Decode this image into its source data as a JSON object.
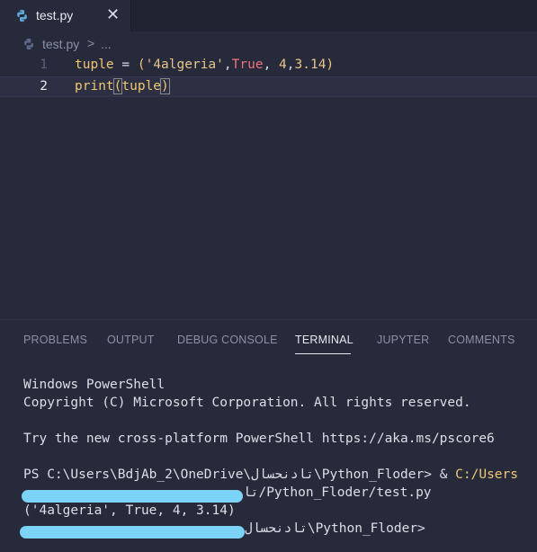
{
  "tab": {
    "filename": "test.py",
    "close_glyph": "✕",
    "icon": "python-icon"
  },
  "breadcrumb": {
    "file": "test.py",
    "separator": ">",
    "ellipsis": "..."
  },
  "editor": {
    "lines": [
      {
        "number": "1"
      },
      {
        "number": "2"
      }
    ],
    "line1": {
      "var": "tuple",
      "eq": " = ",
      "open": "(",
      "str": "'4algeria'",
      "comma1": ",",
      "kw": "True",
      "comma2": ", ",
      "n1": "4",
      "comma3": ",",
      "n2": "3.14",
      "close": ")"
    },
    "line2": {
      "fn": "print",
      "open": "(",
      "arg": "tuple",
      "close": ")"
    }
  },
  "panel": {
    "tabs": [
      "PROBLEMS",
      "OUTPUT",
      "DEBUG CONSOLE",
      "TERMINAL",
      "JUPYTER",
      "COMMENTS"
    ],
    "active_tab": "TERMINAL"
  },
  "terminal": {
    "line1": "Windows PowerShell",
    "line2": "Copyright (C) Microsoft Corporation. All rights reserved.",
    "line3": "Try the new cross-platform PowerShell https://aka.ms/pscore6",
    "line4_prefix": "PS C:\\Users\\BdjAb_2\\OneDrive\\تادنحسال\\Python_Floder> & ",
    "line4_cmd": "C:/Users",
    "line5": "تا/Python_Floder/test.py",
    "line6": "('4algeria', True, 4, 3.14)",
    "line7": "تادنحسال\\Python_Floder>"
  },
  "colors": {
    "background": "#262a3a",
    "redaction": "#7cd3f7"
  }
}
